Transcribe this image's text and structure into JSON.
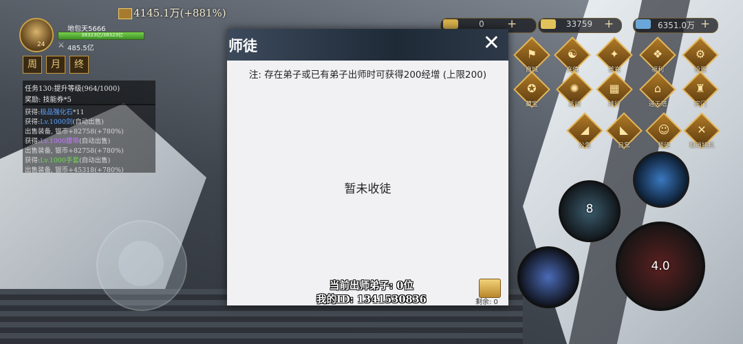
{
  "player": {
    "name": "地包天5666",
    "hp_text": "38323亿/38323亿",
    "hp_fraction": 1.0,
    "power": "485.5亿",
    "level": "24"
  },
  "period_buttons": [
    "周",
    "月",
    "终"
  ],
  "quest": {
    "task": "任务130:提升等级(964/1000)",
    "reward": "奖励: 技能券*5"
  },
  "log": [
    {
      "prefix": "获得:",
      "item": "极品强化石",
      "suffix": "*11",
      "color": "blue"
    },
    {
      "prefix": "获得:",
      "item": "Lv.1000剑",
      "suffix": "(自动出售)",
      "color": "blue"
    },
    {
      "prefix": "出售装备, 银币+82758(+780%)",
      "item": "",
      "suffix": "",
      "color": ""
    },
    {
      "prefix": "获得:",
      "item": "Lv.1000腰带",
      "suffix": "(自动出售)",
      "color": "purple"
    },
    {
      "prefix": "出售装备, 银币+82758(+780%)",
      "item": "",
      "suffix": "",
      "color": ""
    },
    {
      "prefix": "获得:",
      "item": "Lv.1000手套",
      "suffix": "(自动出售)",
      "color": "green"
    },
    {
      "prefix": "出售装备, 银币+45318(+780%)",
      "item": "",
      "suffix": "",
      "color": ""
    }
  ],
  "top_gold": "4145.1万(+881%)",
  "resources": [
    {
      "value": "0",
      "plus": "+",
      "color": "#d8b24a"
    },
    {
      "value": "33759",
      "plus": "+",
      "color": "#e2c25a"
    },
    {
      "value": "6351.0万",
      "plus": "+",
      "color": "#6aa7d8"
    }
  ],
  "menu": [
    {
      "label": "商城",
      "glyph": "⚑"
    },
    {
      "label": "充值",
      "glyph": "☯"
    },
    {
      "label": "首充",
      "glyph": "✦"
    },
    {
      "label": "福利",
      "glyph": "❖"
    },
    {
      "label": "设置",
      "glyph": "⚙"
    },
    {
      "label": "藏宝",
      "glyph": "✪"
    },
    {
      "label": "活动",
      "glyph": "✺"
    },
    {
      "label": "排行",
      "glyph": "▦"
    },
    {
      "label": "通天塔",
      "glyph": "⌂"
    },
    {
      "label": "宗门",
      "glyph": "♜"
    },
    {
      "label": "公告",
      "glyph": "◢"
    },
    {
      "label": "日常",
      "glyph": "◣"
    },
    {
      "label": "师徒",
      "glyph": "☺"
    },
    {
      "label": "取消挂机",
      "glyph": "✕"
    }
  ],
  "skills": [
    {
      "value": "8"
    },
    {
      "value": "4.0"
    }
  ],
  "dialog": {
    "title": "师徒",
    "close": "✕",
    "note": "注: 存在弟子或已有弟子出师时可获得200经增 (上限200)",
    "empty": "暂未收徒",
    "graduated": "当前出师弟子: 0位",
    "my_id": "我的ID: 1341530836",
    "remaining": "剩余: 0"
  }
}
